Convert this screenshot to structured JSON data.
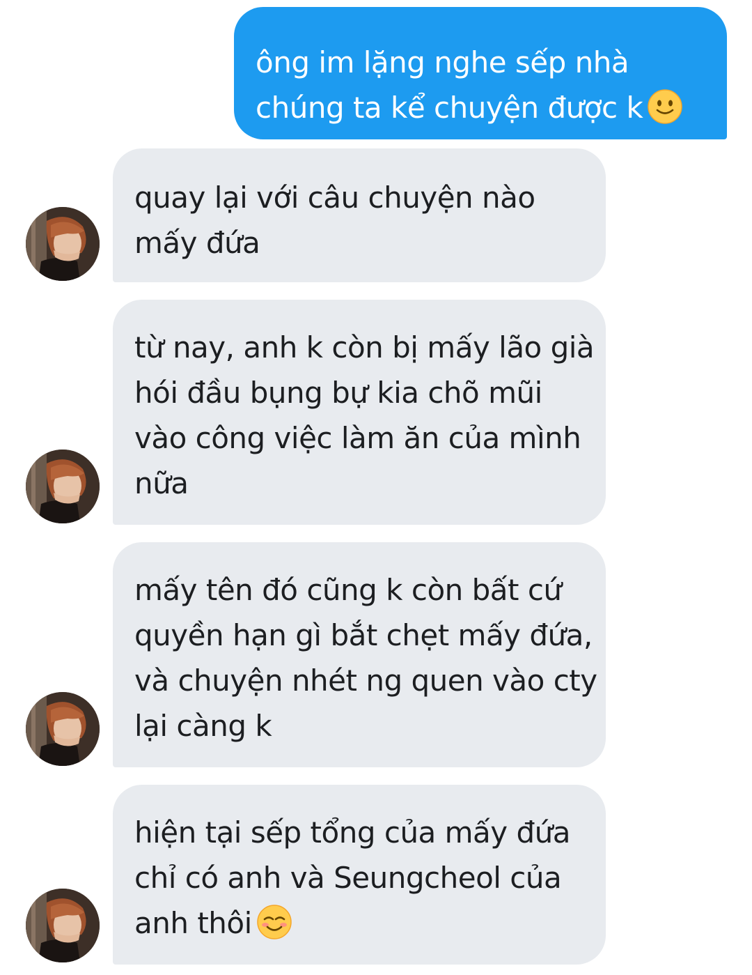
{
  "messages": [
    {
      "direction": "sent",
      "lines": [
        "ông im lặng nghe sếp nhà",
        "chúng ta kể chuyện được k"
      ],
      "emoji": "slightly-smiling-face"
    },
    {
      "direction": "received",
      "lines": [
        "quay lại với câu chuyện nào",
        "mấy đứa"
      ]
    },
    {
      "direction": "received",
      "lines": [
        "từ nay, anh k còn bị mấy lão già",
        "hói đầu bụng bự kia chõ mũi",
        "vào công việc làm ăn của mình",
        "nữa"
      ]
    },
    {
      "direction": "received",
      "lines": [
        "mấy tên đó cũng k còn bất cứ",
        "quyền hạn gì bắt chẹt mấy đứa,",
        "và chuyện nhét ng quen vào cty",
        "lại càng k"
      ]
    },
    {
      "direction": "received",
      "lines": [
        "hiện tại sếp tổng của mấy đứa",
        "chỉ có anh và Seungcheol của",
        "anh thôi"
      ],
      "emoji": "smiling-face"
    }
  ],
  "colors": {
    "sent_bubble": "#1d9bf0",
    "received_bubble": "#e8ebef",
    "received_text": "#1c1e21",
    "sent_text": "#ffffff"
  }
}
